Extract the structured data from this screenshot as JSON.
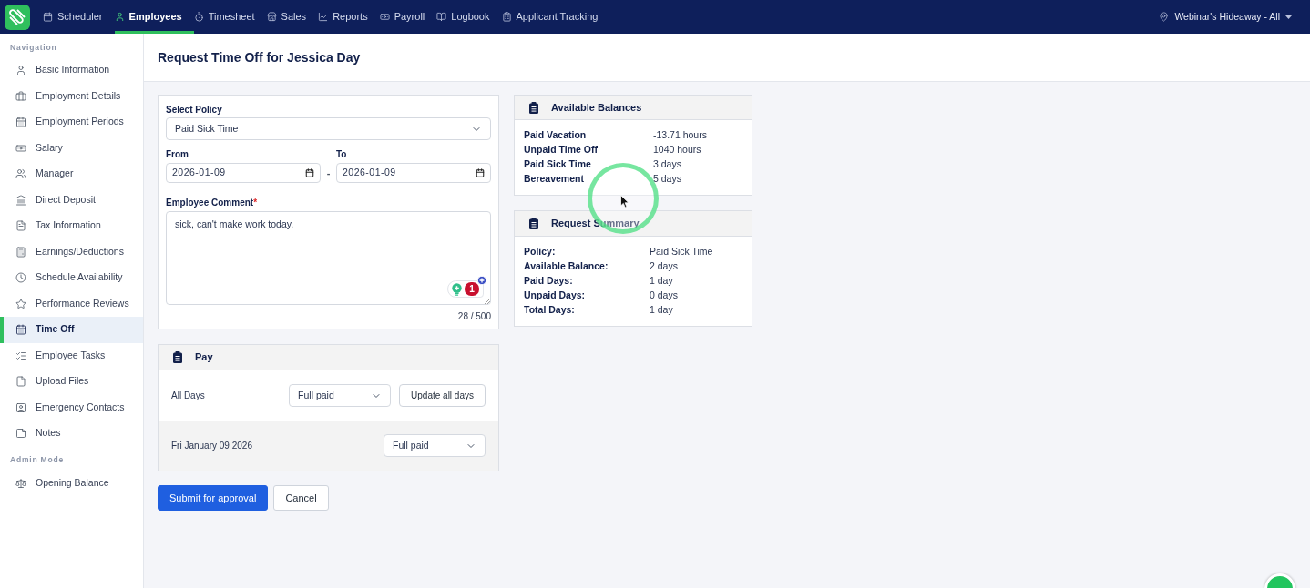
{
  "top_nav": {
    "items": [
      {
        "label": "Scheduler",
        "selected": false
      },
      {
        "label": "Employees",
        "selected": true
      },
      {
        "label": "Timesheet",
        "selected": false
      },
      {
        "label": "Sales",
        "selected": false
      },
      {
        "label": "Reports",
        "selected": false
      },
      {
        "label": "Payroll",
        "selected": false
      },
      {
        "label": "Logbook",
        "selected": false
      },
      {
        "label": "Applicant Tracking",
        "selected": false
      }
    ],
    "location": "Webinar's Hideaway - All"
  },
  "sidebar": {
    "sections": [
      {
        "heading": "Navigation",
        "items": [
          {
            "label": "Basic Information",
            "selected": false
          },
          {
            "label": "Employment Details",
            "selected": false
          },
          {
            "label": "Employment Periods",
            "selected": false
          },
          {
            "label": "Salary",
            "selected": false
          },
          {
            "label": "Manager",
            "selected": false
          },
          {
            "label": "Direct Deposit",
            "selected": false
          },
          {
            "label": "Tax Information",
            "selected": false
          },
          {
            "label": "Earnings/Deductions",
            "selected": false
          },
          {
            "label": "Schedule Availability",
            "selected": false
          },
          {
            "label": "Performance Reviews",
            "selected": false
          },
          {
            "label": "Time Off",
            "selected": true
          },
          {
            "label": "Employee Tasks",
            "selected": false
          },
          {
            "label": "Upload Files",
            "selected": false
          },
          {
            "label": "Emergency Contacts",
            "selected": false
          },
          {
            "label": "Notes",
            "selected": false
          }
        ]
      },
      {
        "heading": "Admin Mode",
        "items": [
          {
            "label": "Opening Balance",
            "selected": false
          }
        ]
      }
    ]
  },
  "page_title": "Request Time Off for Jessica Day",
  "request_form": {
    "policy": {
      "label": "Select Policy",
      "value": "Paid Sick Time"
    },
    "from": {
      "label": "From",
      "value": "2026-01-09"
    },
    "separator": "-",
    "to": {
      "label": "To",
      "value": "2026-01-09"
    },
    "comment": {
      "label": "Employee Comment",
      "required_mark": "*",
      "value": "sick, can't make work today.",
      "assistant_count": "1",
      "counter": "28 / 500"
    }
  },
  "pay": {
    "title": "Pay",
    "all_days": {
      "label": "All Days",
      "value": "Full paid",
      "button": "Update all days"
    },
    "days": [
      {
        "date": "Fri January 09 2026",
        "value": "Full paid"
      }
    ]
  },
  "actions": [
    {
      "label": "Submit for approval",
      "kind": "primary"
    },
    {
      "label": "Cancel",
      "kind": "secondary"
    }
  ],
  "balances": {
    "title": "Available Balances",
    "rows": [
      {
        "label": "Paid Vacation",
        "value": "-13.71 hours"
      },
      {
        "label": "Unpaid Time Off",
        "value": "1040 hours"
      },
      {
        "label": "Paid Sick Time",
        "value": "3 days"
      },
      {
        "label": "Bereavement",
        "value": "5 days"
      }
    ]
  },
  "summary": {
    "title": "Request Summary",
    "rows": [
      {
        "label": "Policy:",
        "value": "Paid Sick Time"
      },
      {
        "label": "Available Balance:",
        "value": "2 days"
      },
      {
        "label": "Paid Days:",
        "value": "1 day"
      },
      {
        "label": "Unpaid Days:",
        "value": "0 days"
      },
      {
        "label": "Total Days:",
        "value": "1 day"
      }
    ]
  }
}
